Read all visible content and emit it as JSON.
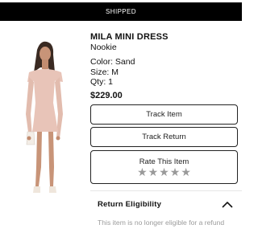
{
  "status_bar": {
    "label": "SHIPPED"
  },
  "product": {
    "image_icon": "dress-model-photo",
    "title": "MILA MINI DRESS",
    "brand": "Nookie",
    "color": "Color: Sand",
    "size": "Size: M",
    "quantity": "Qty: 1",
    "price": "$229.00"
  },
  "actions": {
    "track_item": "Track Item",
    "track_return": "Track Return"
  },
  "rating": {
    "label": "Rate This Item",
    "stars": [
      "★",
      "★",
      "★",
      "★",
      "★"
    ],
    "value": 0,
    "max": 5,
    "star_color": "#9a9a9a"
  },
  "return_eligibility": {
    "title": "Return Eligibility",
    "expanded": true,
    "icon": "chevron-up-icon",
    "message": "This item is no longer eligible for a refund"
  },
  "colors": {
    "header_bg": "#000000",
    "dress": "#e8c4b8",
    "secondary_text": "#9b9b9b"
  }
}
